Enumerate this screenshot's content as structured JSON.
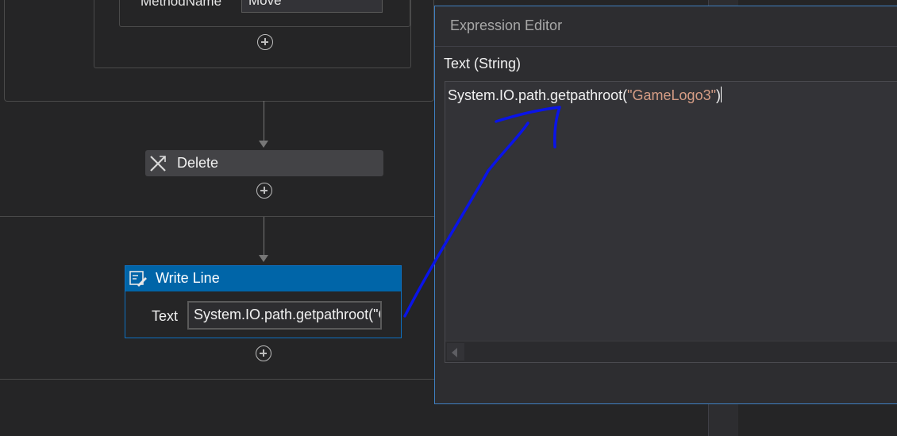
{
  "workflow": {
    "assign_property": {
      "label": "MethodName",
      "value": "Move"
    },
    "delete_activity": {
      "label": "Delete",
      "icon": "delete-x-icon"
    },
    "writeline_activity": {
      "label": "Write Line",
      "icon": "write-line-icon",
      "text_label": "Text",
      "text_value": "System.IO.path.getpathroot(\"GameLogo3\")"
    }
  },
  "expression_editor": {
    "title": "Expression Editor",
    "field_label": "Text (String)",
    "code_prefix": "System.IO.path.getpathroot(",
    "code_string": "\"GameLogo3\"",
    "code_suffix": ")"
  },
  "annotation": {
    "color": "#0a14e8"
  },
  "colors": {
    "accent": "#0065a8",
    "string_literal": "#d69d85"
  }
}
